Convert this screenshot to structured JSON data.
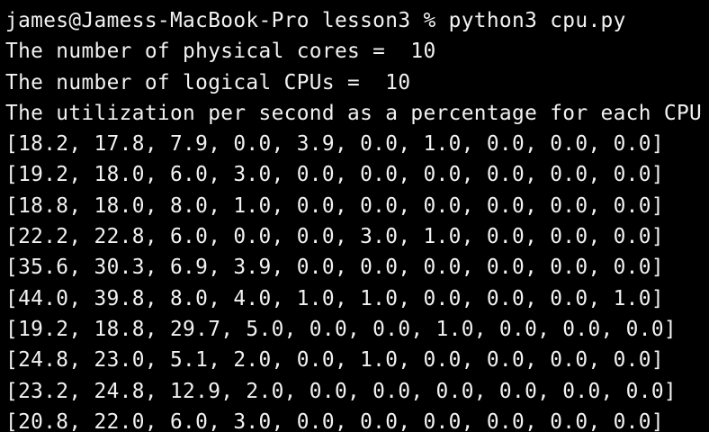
{
  "terminal": {
    "lines": [
      "james@Jamess-MacBook-Pro lesson3 % python3 cpu.py",
      "The number of physical cores =  10",
      "The number of logical CPUs =  10",
      "The utilization per second as a percentage for each CPU",
      "[18.2, 17.8, 7.9, 0.0, 3.9, 0.0, 1.0, 0.0, 0.0, 0.0]",
      "[19.2, 18.0, 6.0, 3.0, 0.0, 0.0, 0.0, 0.0, 0.0, 0.0]",
      "[18.8, 18.0, 8.0, 1.0, 0.0, 0.0, 0.0, 0.0, 0.0, 0.0]",
      "[22.2, 22.8, 6.0, 0.0, 0.0, 3.0, 1.0, 0.0, 0.0, 0.0]",
      "[35.6, 30.3, 6.9, 3.9, 0.0, 0.0, 0.0, 0.0, 0.0, 0.0]",
      "[44.0, 39.8, 8.0, 4.0, 1.0, 1.0, 0.0, 0.0, 0.0, 1.0]",
      "[19.2, 18.8, 29.7, 5.0, 0.0, 0.0, 1.0, 0.0, 0.0, 0.0]",
      "[24.8, 23.0, 5.1, 2.0, 0.0, 1.0, 0.0, 0.0, 0.0, 0.0]",
      "[23.2, 24.8, 12.9, 2.0, 0.0, 0.0, 0.0, 0.0, 0.0, 0.0]",
      "[20.8, 22.0, 6.0, 3.0, 0.0, 0.0, 0.0, 0.0, 0.0, 0.0]"
    ]
  },
  "colors": {
    "background": "#000000",
    "text": "#f2f2f2"
  }
}
